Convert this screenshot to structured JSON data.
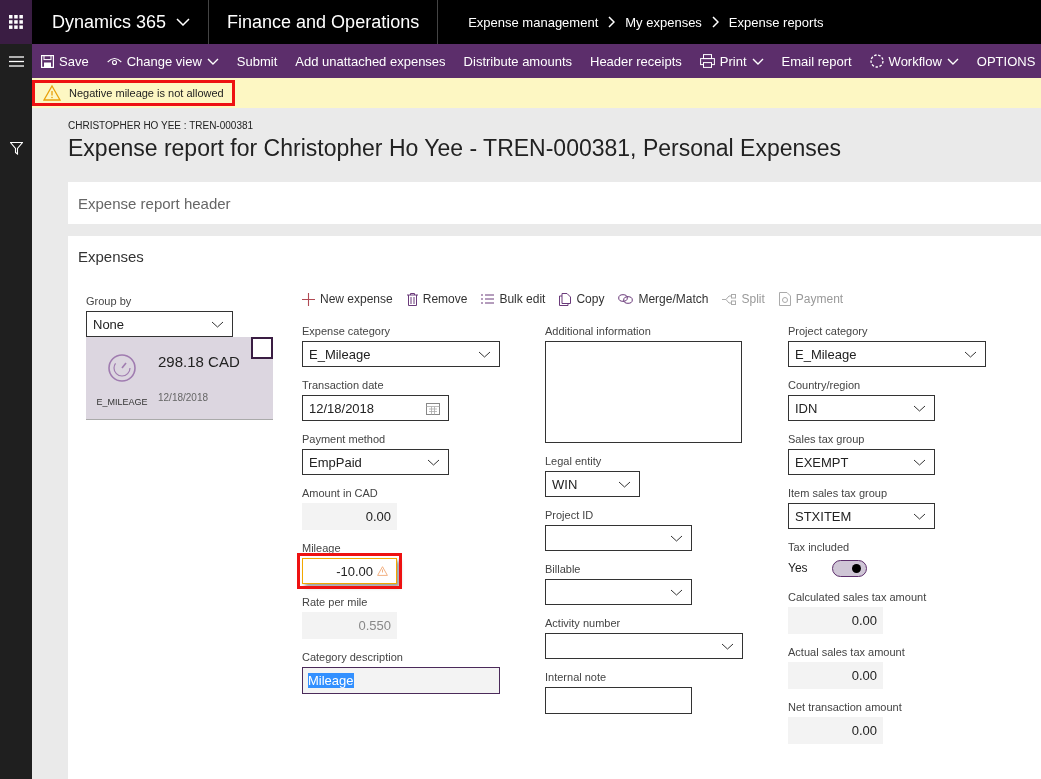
{
  "top_bar": {
    "app_name": "Dynamics 365",
    "module": "Finance and Operations",
    "breadcrumb": [
      "Expense management",
      "My expenses",
      "Expense reports"
    ]
  },
  "action_bar": [
    {
      "label": "Save",
      "kind": "save",
      "dropdown": false
    },
    {
      "label": "Change view",
      "kind": "view",
      "dropdown": true
    },
    {
      "label": "Submit",
      "kind": "plain",
      "dropdown": false
    },
    {
      "label": "Add unattached expenses",
      "kind": "plain",
      "dropdown": false
    },
    {
      "label": "Distribute amounts",
      "kind": "plain",
      "dropdown": false
    },
    {
      "label": "Header receipts",
      "kind": "plain",
      "dropdown": false
    },
    {
      "label": "Print",
      "kind": "print",
      "dropdown": true
    },
    {
      "label": "Email report",
      "kind": "plain",
      "dropdown": false
    },
    {
      "label": "Workflow",
      "kind": "workflow",
      "dropdown": true
    },
    {
      "label": "OPTIONS",
      "kind": "plain",
      "dropdown": false
    }
  ],
  "message_bar": {
    "text": "Negative mileage is not allowed",
    "highlighted": true
  },
  "page": {
    "caption": "CHRISTOPHER HO YEE : TREN-000381",
    "title": "Expense report for Christopher Ho Yee - TREN-000381, Personal Expenses"
  },
  "header_section": {
    "title": "Expense report header"
  },
  "expenses": {
    "title": "Expenses",
    "group_by": {
      "label": "Group by",
      "value": "None"
    },
    "list": [
      {
        "category": "E_MILEAGE",
        "amount": "298.18 CAD",
        "date": "12/18/2018",
        "selected": true,
        "checked": false
      }
    ],
    "toolbar": [
      {
        "label": "New expense",
        "kind": "plus",
        "disabled": false
      },
      {
        "label": "Remove",
        "kind": "trash",
        "disabled": false
      },
      {
        "label": "Bulk edit",
        "kind": "list",
        "disabled": false
      },
      {
        "label": "Copy",
        "kind": "copy",
        "disabled": false
      },
      {
        "label": "Merge/Match",
        "kind": "link",
        "disabled": false
      },
      {
        "label": "Split",
        "kind": "split",
        "disabled": true
      },
      {
        "label": "Payment",
        "kind": "payment",
        "disabled": true
      }
    ],
    "columns": [
      [
        {
          "label": "Expense category",
          "kind": "dropdown",
          "value": "E_Mileage"
        },
        {
          "label": "Transaction date",
          "kind": "date",
          "value": "12/18/2018"
        },
        {
          "label": "Payment method",
          "kind": "dropdown",
          "value": "EmpPaid"
        },
        {
          "label": "Amount in CAD",
          "kind": "readonly",
          "value": "0.00"
        },
        {
          "label": "Mileage",
          "kind": "number",
          "value": "-10.00",
          "error": true
        },
        {
          "label": "Rate per mile",
          "kind": "readonly",
          "value": "0.550",
          "dimmed": true
        },
        {
          "label": "Category description",
          "kind": "text",
          "value": "Mileage",
          "text_selected": true
        }
      ],
      [
        {
          "label": "Additional information",
          "kind": "textarea"
        },
        {
          "label": "Legal entity",
          "kind": "dropdown",
          "value": "WIN"
        },
        {
          "label": "Project ID",
          "kind": "dropdown"
        },
        {
          "label": "Billable",
          "kind": "dropdown"
        },
        {
          "label": "Activity number",
          "kind": "dropdown"
        },
        {
          "label": "Internal note",
          "kind": "text"
        }
      ],
      [
        {
          "label": "Project category",
          "kind": "dropdown",
          "value": "E_Mileage"
        },
        {
          "label": "Country/region",
          "kind": "dropdown",
          "value": "IDN"
        },
        {
          "label": "Sales tax group",
          "kind": "dropdown",
          "value": "EXEMPT"
        },
        {
          "label": "Item sales tax group",
          "kind": "dropdown",
          "value": "STXITEM"
        },
        {
          "label": "Tax included",
          "kind": "toggle",
          "value": "Yes",
          "on": true
        },
        {
          "label": "Calculated sales tax amount",
          "kind": "readonly",
          "value": "0.00"
        },
        {
          "label": "Actual sales tax amount",
          "kind": "readonly",
          "value": "0.00"
        },
        {
          "label": "Net transaction amount",
          "kind": "readonly",
          "value": "0.00"
        }
      ]
    ]
  }
}
